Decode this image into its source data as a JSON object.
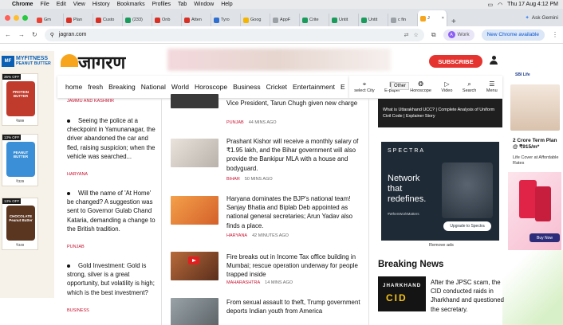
{
  "menubar": {
    "apple": "",
    "app": "Chrome",
    "items": [
      "File",
      "Edit",
      "View",
      "History",
      "Bookmarks",
      "Profiles",
      "Tab",
      "Window",
      "Help"
    ],
    "datetime": "Thu 17 Aug  4:12 PM"
  },
  "tabs": [
    {
      "label": "Gm",
      "color": "#ea4335"
    },
    {
      "label": "Plan",
      "color": "#d93025"
    },
    {
      "label": "Custo",
      "color": "#d93025"
    },
    {
      "label": "(233)",
      "color": "#1a9b5b"
    },
    {
      "label": "Onb",
      "color": "#d93025"
    },
    {
      "label": "Atten",
      "color": "#d93025"
    },
    {
      "label": "Tyro",
      "color": "#2f6fd1"
    },
    {
      "label": "Goog",
      "color": "#f4b400"
    },
    {
      "label": "AppF",
      "color": "#9aa0a6"
    },
    {
      "label": "Crite",
      "color": "#1a9b5b"
    },
    {
      "label": "Untit",
      "color": "#1a9b5b"
    },
    {
      "label": "Untit",
      "color": "#1a9b5b"
    },
    {
      "label": "c fin",
      "color": "#9aa0a6"
    },
    {
      "label": "J",
      "color": "#f6a51c"
    }
  ],
  "ask_gemini": "Ask Gemini",
  "address": {
    "url": "jagran.com",
    "profile": "Work",
    "profile_initial": "A",
    "update": "New Chrome available"
  },
  "left_ad": {
    "brand": "MYFITNESS",
    "sub": "PEANUT BUTTER",
    "products": [
      {
        "off": "35% OFF",
        "name": "PROTEIN BUTTER",
        "price": "₹699",
        "color": "#c03b2b"
      },
      {
        "off": "13% OFF",
        "name": "PEANUT BUTTER",
        "price": "₹329",
        "color": "#3a8fd6"
      },
      {
        "off": "13% OFF",
        "name": "CHOCOLATE Peanut Butter",
        "price": "₹349",
        "color": "#5a3520"
      }
    ]
  },
  "header": {
    "logo": "जागरण",
    "subscribe": "SUBSCRIBE"
  },
  "nav": {
    "items": [
      "home",
      "fresh",
      "Breaking",
      "National",
      "World",
      "Horoscope",
      "Business",
      "Cricket",
      "Entertainment",
      "E"
    ],
    "icons": [
      {
        "label": "select City",
        "icon": "location-pin-icon",
        "glyph": "⌖"
      },
      {
        "label": "E-paper",
        "icon": "epaper-icon",
        "glyph": "▤"
      },
      {
        "label": "Horoscope",
        "icon": "horoscope-icon",
        "glyph": "❂"
      },
      {
        "label": "Video",
        "icon": "video-icon",
        "glyph": "▷"
      },
      {
        "label": "Search",
        "icon": "search-icon",
        "glyph": "⌕"
      },
      {
        "label": "Menu",
        "icon": "menu-icon",
        "glyph": "☰"
      }
    ],
    "tooltip": "Other"
  },
  "left_news": [
    {
      "tag": "JAMMU AND KASHMIR",
      "headline": ""
    },
    {
      "tag": "HARYANA",
      "headline": "Seeing the police at a checkpoint in Yamunanagar, the driver abandoned the car and fled, raising suspicion; when the vehicle was searched..."
    },
    {
      "tag": "PUNJAB",
      "headline": "Will the name of 'At Home' be changed? A suggestion was sent to Governor Gulab Chand Kataria, demanding a change to the British tradition."
    },
    {
      "tag": "BUSINESS",
      "headline": "Gold Investment: Gold is strong, silver is a great opportunity, but volatility is high; which is the best investment?"
    }
  ],
  "center_news": [
    {
      "headline": "Vice President, Tarun Chugh given new charge",
      "tag": "PUNJAB",
      "time": "44 MINS AGO"
    },
    {
      "headline": "Prashant Kishor will receive a monthly salary of ₹1.95 lakh, and the Bihar government will also provide the Bankipur MLA with a house and bodyguard.",
      "tag": "BIHAR",
      "time": "50 MINS AGO"
    },
    {
      "headline": "Haryana dominates the BJP's national team! Sanjay Bhatia and Biplab Deb appointed as national general secretaries; Arun Yadav also finds a place.",
      "tag": "HARYANA",
      "time": "42 MINUTES AGO"
    },
    {
      "headline": "Fire breaks out in Income Tax office building in Mumbai; rescue operation underway for people trapped inside",
      "tag": "MAHARASHTRA",
      "time": "14 MINS AGO"
    },
    {
      "headline": "From sexual assault to theft, Trump government deports Indian youth from America",
      "tag": "",
      "time": ""
    }
  ],
  "right_col": {
    "video_caption": "What is Uttarakhand UCC? | Complete Analysis of Uniform Civil Code | Explainer Story",
    "spectra": {
      "brand": "SPECTRA",
      "headline": "Network that redefines.",
      "hashtag": "#WhenWorkMatters",
      "cta": "Upgrade to Spectra"
    },
    "remove_ads": "Remove ads",
    "breaking_title": "Breaking News",
    "breaking_thumb_a": "JHARKHAND",
    "breaking_thumb_b": "CID",
    "breaking_headline": "After the JPSC scam, the CID conducted raids in Jharkhand and questioned the secretary."
  },
  "right_ad": {
    "brand": "SBI Life",
    "plan_title": "2 Crore Term Plan @ ₹915/m*",
    "plan_sub": "Life Cover at Affordable Rates",
    "cta": "Buy Now"
  }
}
